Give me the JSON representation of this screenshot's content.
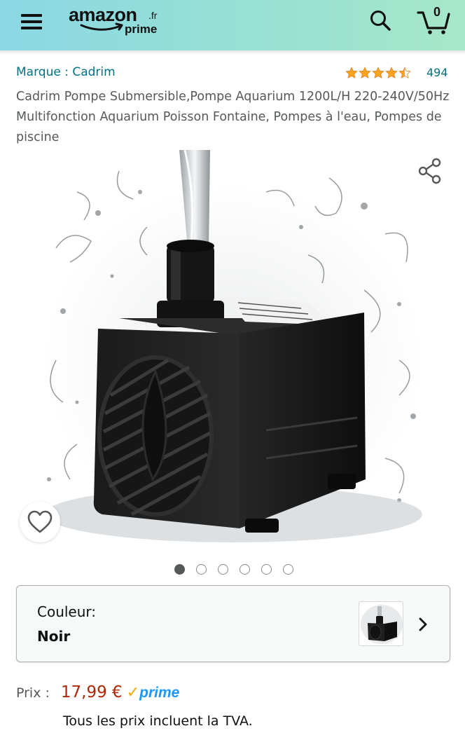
{
  "header": {
    "logo_main": "amazon",
    "logo_tld": ".fr",
    "logo_sub": "prime",
    "cart_count": "0",
    "icons": [
      "menu-icon",
      "search-icon",
      "cart-icon"
    ]
  },
  "product": {
    "brand_link": "Marque : Cadrim",
    "rating": 4.5,
    "review_count": "494",
    "title": "Cadrim Pompe Submersible,Pompe Aquarium 1200L/H 220-240V/50Hz Multifonction Aquarium Poisson Fontaine, Pompes à l'eau, Pompes de piscine",
    "image_alt_icons": [
      "share-icon",
      "heart-icon"
    ],
    "carousel": {
      "count": 6,
      "active_index": 0
    }
  },
  "variation": {
    "label": "Couleur:",
    "value": "Noir"
  },
  "price": {
    "label": "Prix :",
    "value": "17,99 €",
    "prime_label": "prime",
    "tax_note": "Tous les prix incluent la TVA."
  },
  "colors": {
    "header_gradient_start": "#8ad8e4",
    "header_gradient_end": "#a7e7c9",
    "link": "#007185",
    "price": "#b12704",
    "star": "#ffa41c",
    "prime_blue": "#1a98ff",
    "prime_check": "#f7a600"
  }
}
